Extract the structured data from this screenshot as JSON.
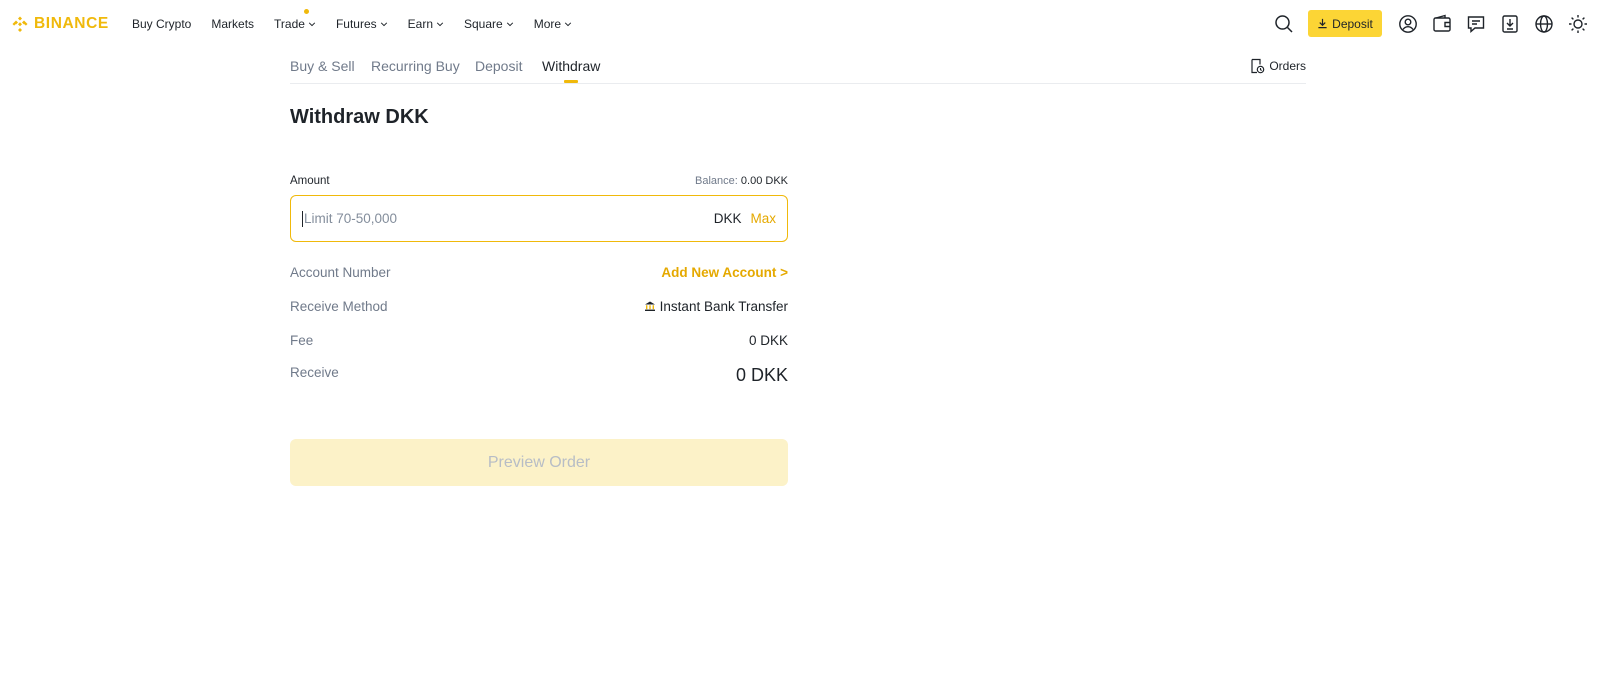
{
  "brand": {
    "name": "BINANCE",
    "color": "#F0B90B"
  },
  "nav": {
    "items": [
      {
        "label": "Buy Crypto",
        "dropdown": false
      },
      {
        "label": "Markets",
        "dropdown": false
      },
      {
        "label": "Trade",
        "dropdown": true,
        "dot": true
      },
      {
        "label": "Futures",
        "dropdown": true
      },
      {
        "label": "Earn",
        "dropdown": true
      },
      {
        "label": "Square",
        "dropdown": true
      },
      {
        "label": "More",
        "dropdown": true
      }
    ],
    "deposit_label": "Deposit",
    "icons": [
      "search-icon",
      "download-icon",
      "user-icon",
      "wallet-icon",
      "messages-icon",
      "app-download-icon",
      "globe-icon",
      "theme-sun-icon"
    ]
  },
  "tabs": {
    "items": [
      "Buy & Sell",
      "Recurring Buy",
      "Deposit",
      "Withdraw"
    ],
    "active": "Withdraw",
    "orders_label": "Orders"
  },
  "form": {
    "title": "Withdraw DKK",
    "amount_label": "Amount",
    "balance_label": "Balance:",
    "balance_value": "0.00 DKK",
    "amount_value": "",
    "amount_placeholder": "Limit 70-50,000",
    "currency": "DKK",
    "max_label": "Max",
    "account_number_label": "Account Number",
    "add_account_label": "Add New Account >",
    "receive_method_label": "Receive Method",
    "receive_method_value": "Instant Bank Transfer",
    "fee_label": "Fee",
    "fee_value": "0 DKK",
    "receive_label": "Receive",
    "receive_value": "0 DKK",
    "preview_label": "Preview Order"
  }
}
